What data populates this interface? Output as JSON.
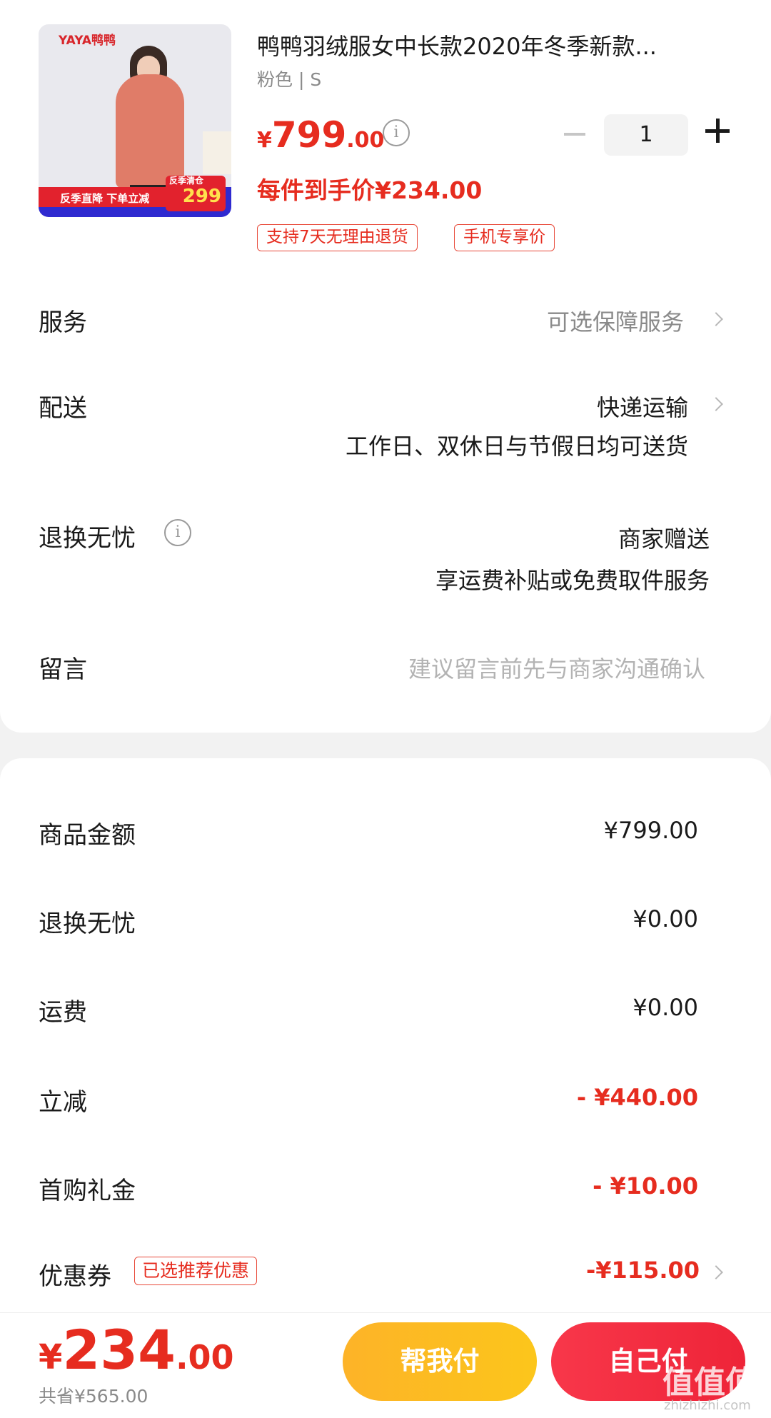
{
  "product": {
    "image_brand": "YAYA鸭鸭",
    "image_promo": "反季直降 下单立减",
    "image_badge_tag": "反季清仓",
    "image_badge_price": "299",
    "title": "鸭鸭羽绒服女中长款2020年冬季新款...",
    "spec": "粉色 | S",
    "price_yen": "¥",
    "price_int": "799",
    "price_dec": ".00",
    "quantity": "1",
    "final_price": "每件到手价¥234.00",
    "tags": [
      "支持7天无理由退货",
      "手机专享价"
    ]
  },
  "rows": {
    "service": {
      "label": "服务",
      "value": "可选保障服务"
    },
    "delivery": {
      "label": "配送",
      "value": "快递运输",
      "detail": "工作日、双休日与节假日均可送货"
    },
    "returns": {
      "label": "退换无忧",
      "value": "商家赠送",
      "detail": "享运费补贴或免费取件服务"
    },
    "message": {
      "label": "留言",
      "placeholder": "建议留言前先与商家沟通确认"
    }
  },
  "summary": {
    "goods": {
      "label": "商品金额",
      "value": "¥799.00"
    },
    "returns": {
      "label": "退换无忧",
      "value": "¥0.00"
    },
    "shipping": {
      "label": "运费",
      "value": "¥0.00"
    },
    "discount": {
      "label": "立减",
      "value": "- ¥440.00"
    },
    "first_gift": {
      "label": "首购礼金",
      "value": "- ¥10.00"
    },
    "coupon": {
      "label": "优惠券",
      "tag": "已选推荐优惠",
      "value": "-¥115.00"
    }
  },
  "footer": {
    "total_yen": "¥",
    "total_int": "234",
    "total_dec": ".00",
    "saved": "共省¥565.00",
    "help_pay": "帮我付",
    "self_pay": "自己付",
    "watermark": "值值值",
    "watermark_url": "zhizhizhi.com"
  },
  "colors": {
    "accent": "#e62c1f",
    "help_button": "#fcc61b",
    "self_button": "#f02a3f"
  }
}
